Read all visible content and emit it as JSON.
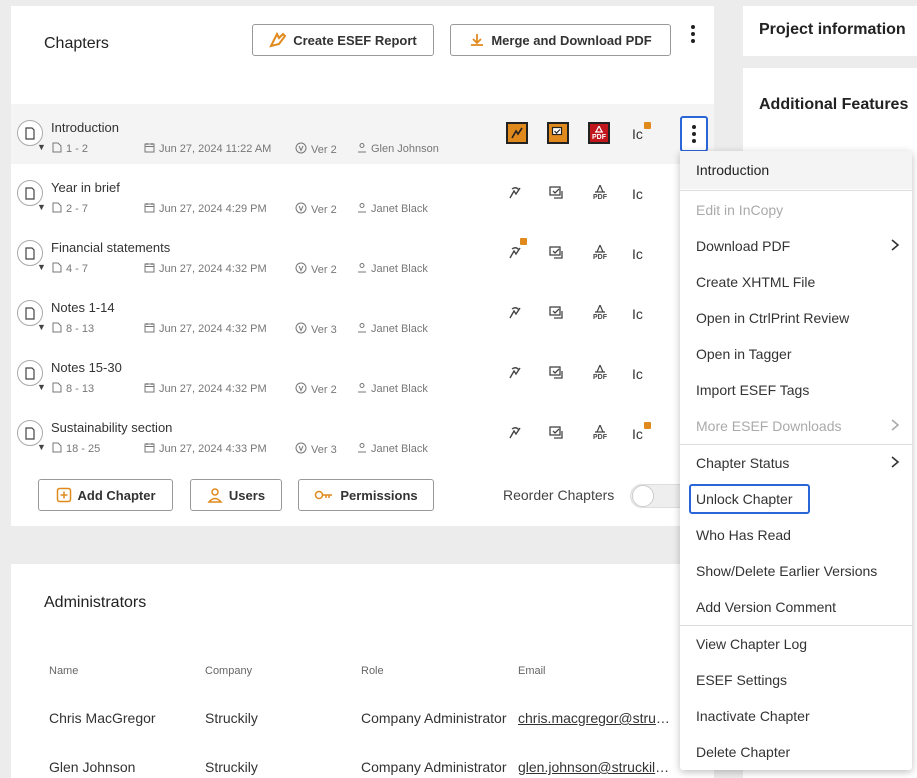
{
  "chapters": {
    "title": "Chapters",
    "create_esef_label": "Create ESEF Report",
    "merge_download_label": "Merge and Download PDF",
    "rows": [
      {
        "title": "Introduction",
        "pages": "1 - 2",
        "date": "Jun 27, 2024 11:22 AM",
        "version": "Ver 2",
        "user": "Glen Johnson"
      },
      {
        "title": "Year in brief",
        "pages": "2 - 7",
        "date": "Jun 27, 2024 4:29 PM",
        "version": "Ver 2",
        "user": "Janet Black"
      },
      {
        "title": "Financial statements",
        "pages": "4 - 7",
        "date": "Jun 27, 2024 4:32 PM",
        "version": "Ver 2",
        "user": "Janet Black"
      },
      {
        "title": "Notes 1-14",
        "pages": "8 - 13",
        "date": "Jun 27, 2024 4:32 PM",
        "version": "Ver 3",
        "user": "Janet Black"
      },
      {
        "title": "Notes 15-30",
        "pages": "8 - 13",
        "date": "Jun 27, 2024 4:32 PM",
        "version": "Ver 2",
        "user": "Janet Black"
      },
      {
        "title": "Sustainability section",
        "pages": "18 - 25",
        "date": "Jun 27, 2024 4:33 PM",
        "version": "Ver 3",
        "user": "Janet Black"
      }
    ],
    "ic_label": "Ic",
    "pdf_label": "PDF",
    "add_chapter_label": "Add Chapter",
    "users_label": "Users",
    "permissions_label": "Permissions",
    "reorder_label": "Reorder Chapters",
    "reorder_on": false
  },
  "admins": {
    "title": "Administrators",
    "columns": [
      "Name",
      "Company",
      "Role",
      "Email"
    ],
    "rows": [
      {
        "name": "Chris MacGregor",
        "company": "Struckily",
        "role": "Company Administrator",
        "email": "chris.macgregor@struckily.com"
      },
      {
        "name": "Glen Johnson",
        "company": "Struckily",
        "role": "Company Administrator",
        "email": "glen.johnson@struckily.com"
      }
    ]
  },
  "side": {
    "project_info": "Project information",
    "additional_features": "Additional Features"
  },
  "menu": {
    "header": "Introduction",
    "items": [
      {
        "label": "Edit in InCopy",
        "disabled": true
      },
      {
        "label": "Download PDF",
        "submenu": true
      },
      {
        "label": "Create XHTML File"
      },
      {
        "label": "Open in CtrlPrint Review"
      },
      {
        "label": "Open in Tagger"
      },
      {
        "label": "Import ESEF Tags"
      },
      {
        "label": "More ESEF Downloads",
        "disabled": true,
        "submenu": true
      },
      {
        "label": "Chapter Status",
        "submenu": true
      },
      {
        "label": "Unlock Chapter"
      },
      {
        "label": "Who Has Read"
      },
      {
        "label": "Show/Delete Earlier Versions"
      },
      {
        "label": "Add Version Comment"
      },
      {
        "label": "View Chapter Log"
      },
      {
        "label": "ESEF Settings"
      },
      {
        "label": "Inactivate Chapter"
      },
      {
        "label": "Delete Chapter"
      }
    ]
  },
  "colors": {
    "accent_orange": "#e08a1e",
    "focus_blue": "#2b66d9",
    "pdf_red": "#c0161c"
  }
}
